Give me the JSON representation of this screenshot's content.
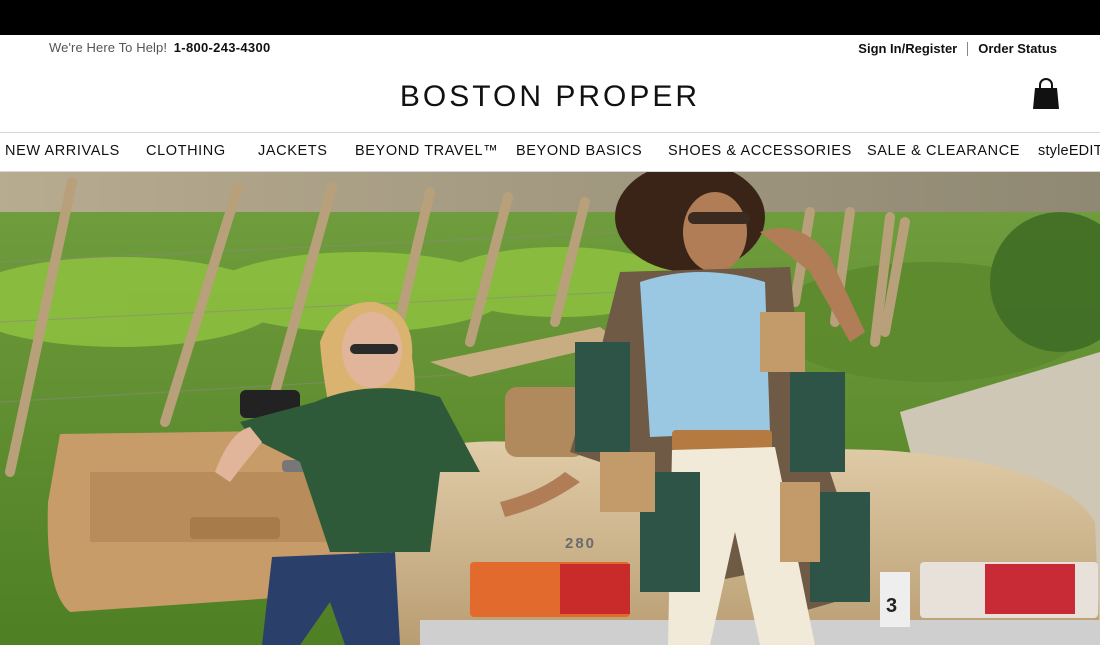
{
  "promo_bar": {
    "text": ""
  },
  "utility": {
    "help_text": "We're Here To Help!",
    "phone": "1-800-243-4300",
    "sign_in": "Sign In/Register",
    "order_status": "Order Status"
  },
  "brand": {
    "logo": "BOSTON PROPER"
  },
  "nav": {
    "items": [
      {
        "label": "NEW ARRIVALS"
      },
      {
        "label": "CLOTHING"
      },
      {
        "label": "JACKETS"
      },
      {
        "label": "BEYOND TRAVEL™"
      },
      {
        "label": "BEYOND BASICS"
      },
      {
        "label": "SHOES & ACCESSORIES"
      },
      {
        "label": "SALE & CLEARANCE"
      },
      {
        "label": "styleEDIT"
      }
    ]
  },
  "hero": {
    "car_badge": "280",
    "plate_fragment": "3"
  },
  "icons": {
    "cart": "shopping-bag-icon"
  },
  "colors": {
    "promo_bar": "#000000",
    "text": "#111111",
    "divider": "#d6d6d6"
  }
}
